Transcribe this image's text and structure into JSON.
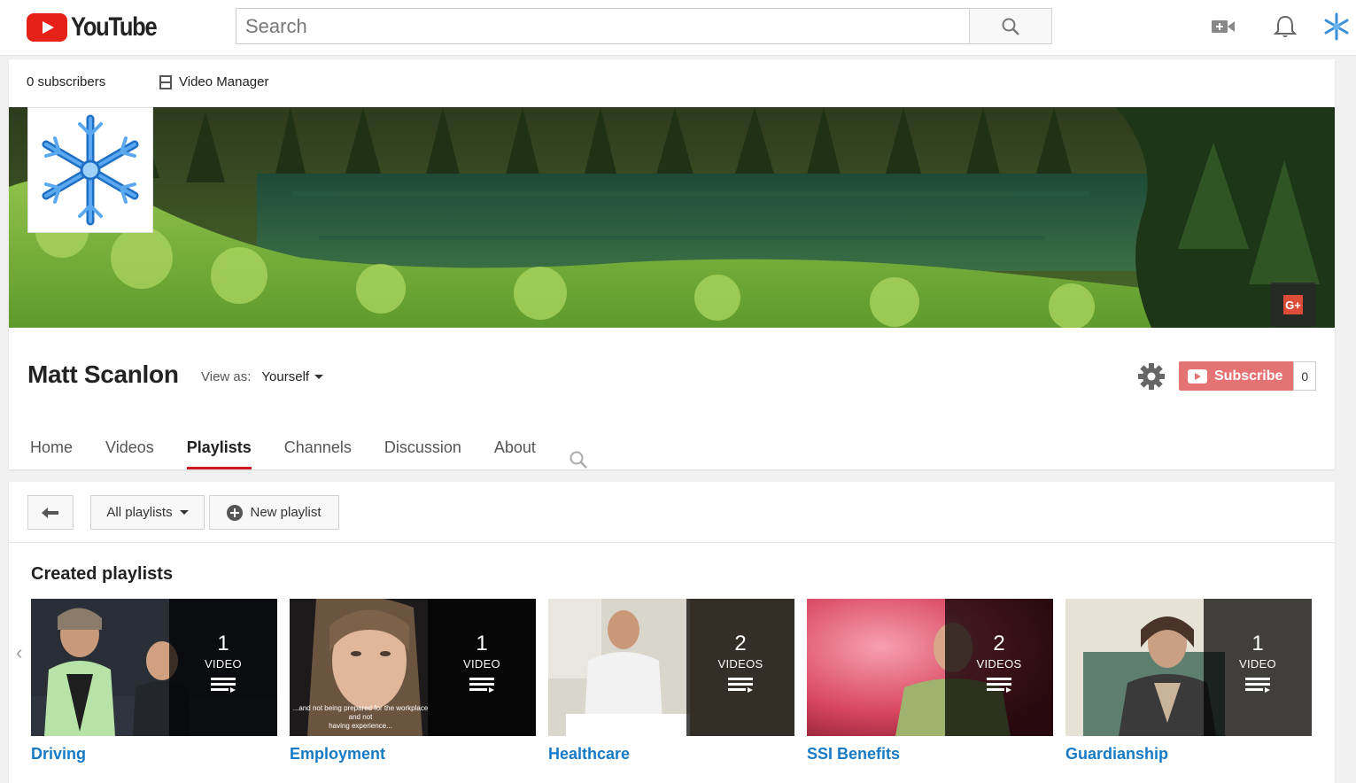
{
  "masthead": {
    "logo_text": "YouTube",
    "search_placeholder": "Search"
  },
  "channel": {
    "subscribers": "0 subscribers",
    "video_manager": "Video Manager",
    "name": "Matt Scanlon",
    "view_as_label": "View as:",
    "view_as_value": "Yourself",
    "gplus_label": "G+",
    "subscribe_label": "Subscribe",
    "subscribe_count": "0"
  },
  "tabs": [
    {
      "label": "Home"
    },
    {
      "label": "Videos"
    },
    {
      "label": "Playlists",
      "active": true
    },
    {
      "label": "Channels"
    },
    {
      "label": "Discussion"
    },
    {
      "label": "About"
    }
  ],
  "toolbar": {
    "filter_label": "All playlists",
    "new_playlist_label": "New playlist"
  },
  "section_title": "Created playlists",
  "playlists": [
    {
      "title": "Driving",
      "count": "1",
      "unit": "VIDEO"
    },
    {
      "title": "Employment",
      "count": "1",
      "unit": "VIDEO",
      "subtitle_line1": "...and not being prepared for the workplace and not",
      "subtitle_line2": "having experience..."
    },
    {
      "title": "Healthcare",
      "count": "2",
      "unit": "VIDEOS"
    },
    {
      "title": "SSI Benefits",
      "count": "2",
      "unit": "VIDEOS"
    },
    {
      "title": "Guardianship",
      "count": "1",
      "unit": "VIDEO"
    }
  ],
  "colors": {
    "brand_red": "#e62117",
    "link_blue": "#167ac6",
    "tab_underline": "#cc181e",
    "subscribe_disabled": "#e57373"
  },
  "icons": [
    "search-icon",
    "video-upload-icon",
    "bell-icon",
    "snowflake-avatar-icon",
    "video-manager-icon",
    "gear-icon",
    "back-arrow-icon",
    "plus-circle-icon",
    "chevron-left-icon",
    "playlist-lines-icon"
  ]
}
